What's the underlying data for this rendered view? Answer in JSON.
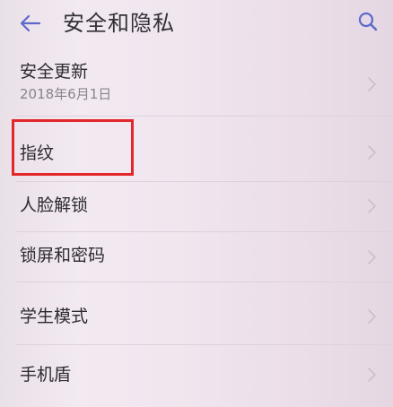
{
  "header": {
    "title": "安全和隐私",
    "back_icon": "back-arrow-icon",
    "search_icon": "search-icon"
  },
  "items": [
    {
      "label": "安全更新",
      "sub": "2018年6月1日"
    },
    {
      "label": "指纹"
    },
    {
      "label": "人脸解锁"
    },
    {
      "label": "锁屏和密码"
    },
    {
      "label": "学生模式"
    },
    {
      "label": "手机盾"
    }
  ],
  "colors": {
    "accent": "#5b6ac9",
    "highlight_border": "#e3262a"
  }
}
